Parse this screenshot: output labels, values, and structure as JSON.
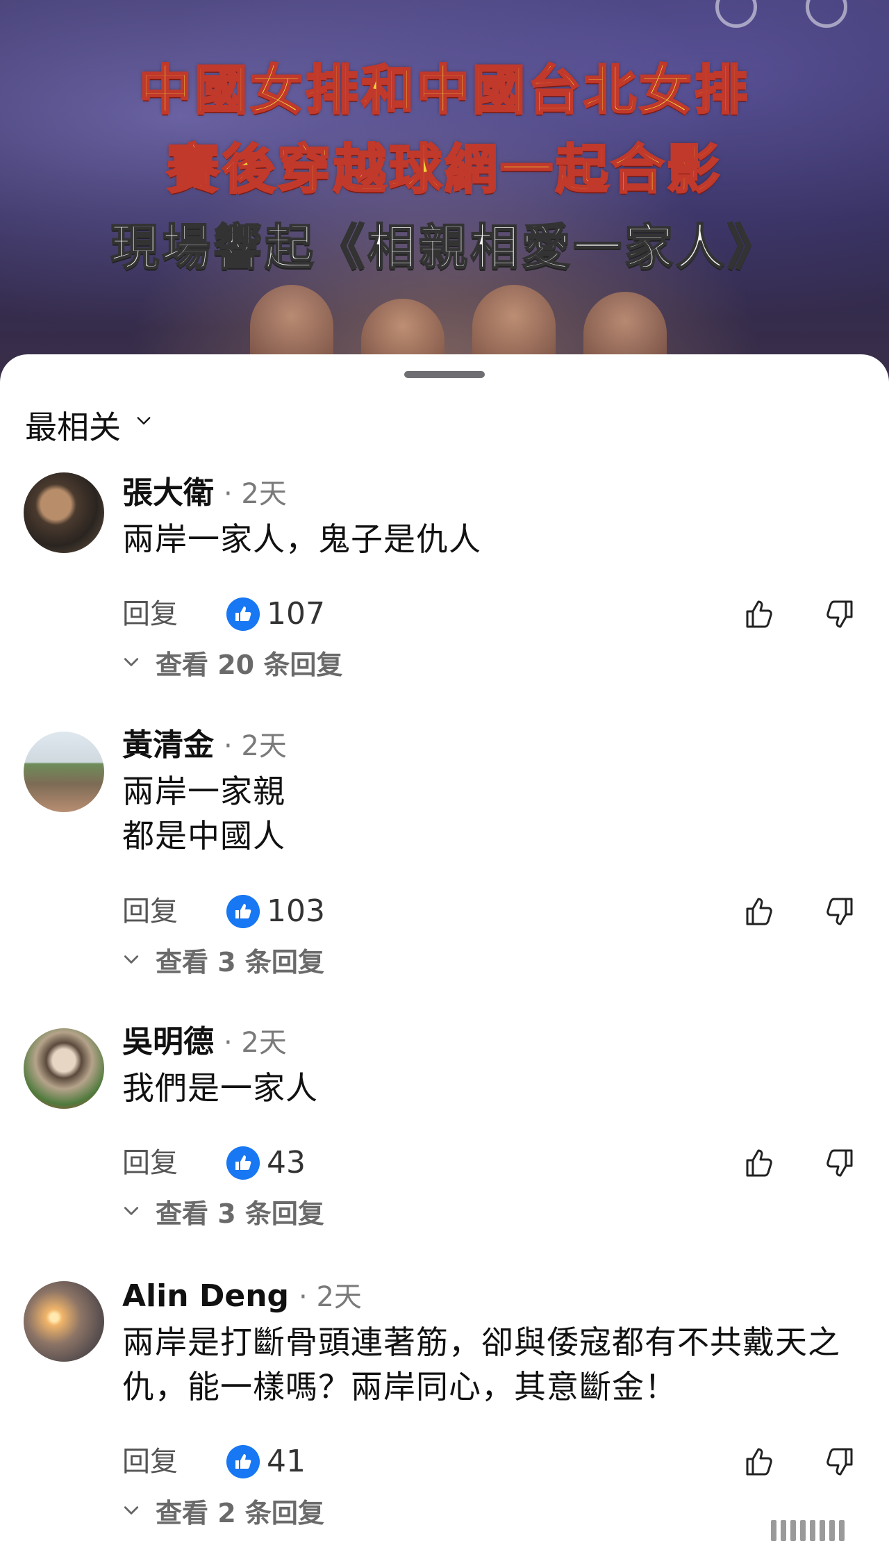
{
  "video": {
    "title_line1": "中國女排和中國台北女排",
    "title_line2": "賽後穿越球網一起合影",
    "title_line3": "現場響起《相親相愛一家人》"
  },
  "sheet": {
    "sort_label": "最相关"
  },
  "comments": [
    {
      "author": "張大衛",
      "time": "· 2天",
      "text": "兩岸一家人，鬼子是仇人",
      "reply_label": "回复",
      "likes": "107",
      "view_replies": "查看 20 条回复"
    },
    {
      "author": "黃清金",
      "time": "· 2天",
      "text": "兩岸一家親\n都是中國人",
      "reply_label": "回复",
      "likes": "103",
      "view_replies": "查看 3 条回复"
    },
    {
      "author": "吳明德",
      "time": "· 2天",
      "text": "我們是一家人",
      "reply_label": "回复",
      "likes": "43",
      "view_replies": "查看 3 条回复"
    },
    {
      "author": "Alin Deng",
      "time": "· 2天",
      "text": "兩岸是打斷骨頭連著筋，卻與倭寇都有不共戴天之仇，能一樣嗎？兩岸同心，其意斷金！",
      "reply_label": "回复",
      "likes": "41",
      "view_replies": "查看 2 条回复"
    }
  ],
  "colors": {
    "like_blue": "#1877f2",
    "title_yellow": "#f4d43a",
    "title_outline_red": "#c0392b"
  }
}
